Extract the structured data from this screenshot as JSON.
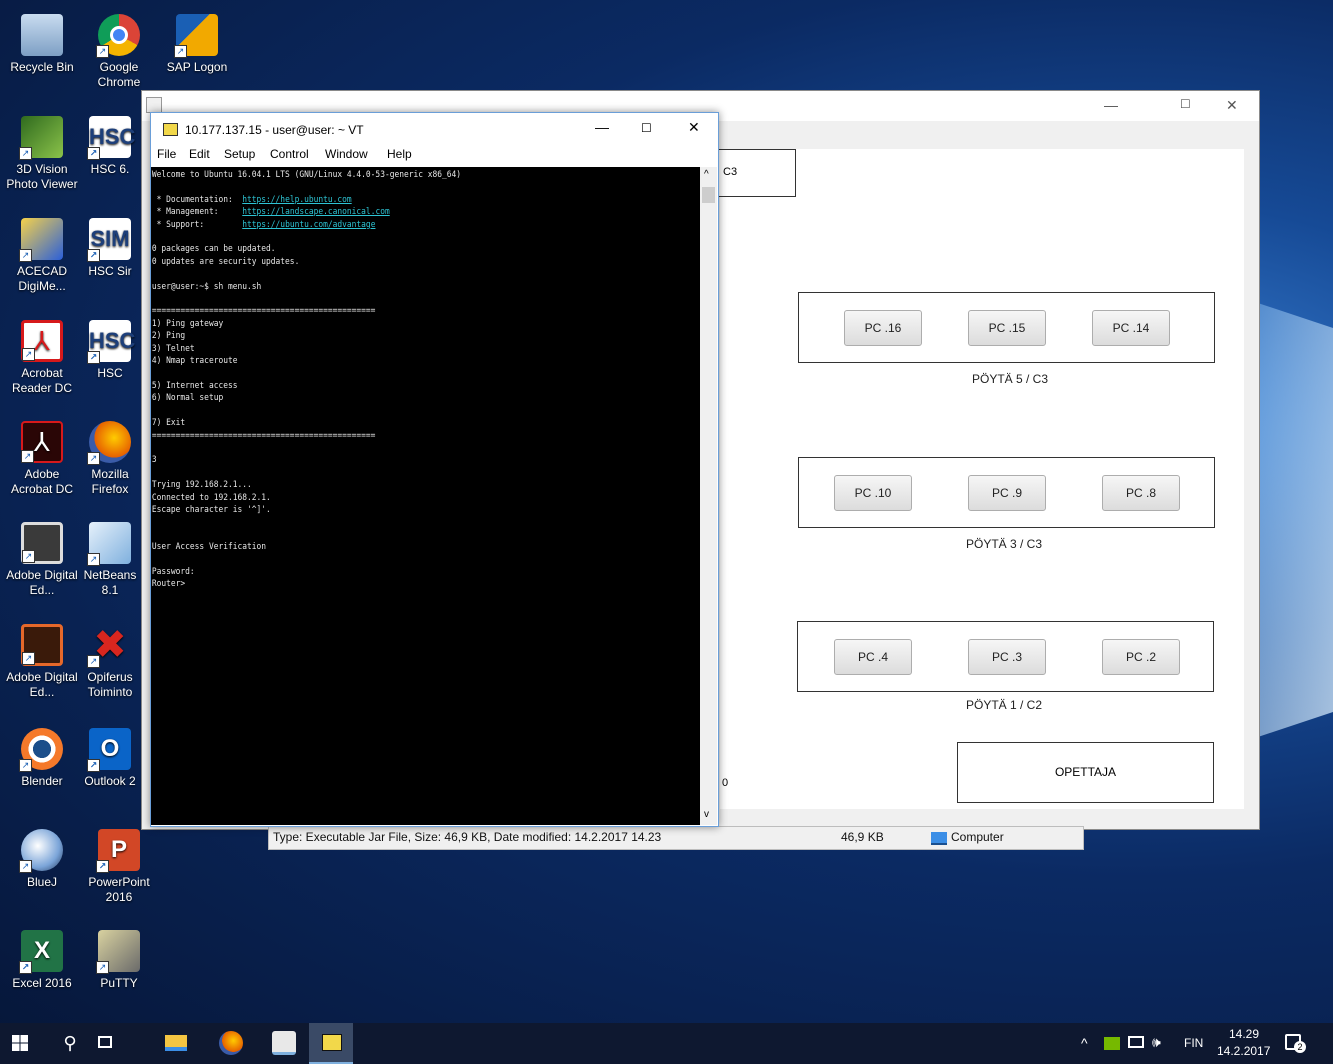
{
  "desktop": {
    "icons": [
      {
        "label": "Recycle Bin",
        "icon": "recycle-bin-icon",
        "color": "#9ab8d8"
      },
      {
        "label": "Google Chrome",
        "icon": "chrome-icon",
        "color": "#db4437"
      },
      {
        "label": "SAP Logon",
        "icon": "sap-logon-icon",
        "color": "#f2a900"
      },
      {
        "label": "3D Vision Photo Viewer",
        "icon": "3d-vision-icon",
        "color": "#4a8a2a"
      },
      {
        "label": "HSC 6.",
        "icon": "hsc-icon",
        "color": "#2a4f8f"
      },
      {
        "label": "ACECAD DigiMe...",
        "icon": "acecad-icon",
        "color": "#2b5fd9"
      },
      {
        "label": "HSC Sir",
        "icon": "hsc-sim-icon",
        "color": "#2a4f8f"
      },
      {
        "label": "Acrobat Reader DC",
        "icon": "acrobat-reader-icon",
        "color": "#d6191b"
      },
      {
        "label": "HSC",
        "icon": "hsc-icon-2",
        "color": "#2a4f8f"
      },
      {
        "label": "Adobe Acrobat DC",
        "icon": "adobe-acrobat-icon",
        "color": "#d6191b"
      },
      {
        "label": "Mozilla Firefox",
        "icon": "firefox-icon",
        "color": "#e66000"
      },
      {
        "label": "Adobe Digital Ed...",
        "icon": "adobe-digital-editions-icon",
        "color": "#4a4a4a"
      },
      {
        "label": "NetBeans 8.1",
        "icon": "netbeans-icon",
        "color": "#9fc6e8"
      },
      {
        "label": "Adobe Digital Ed...",
        "icon": "adobe-digital-editions-icon-2",
        "color": "#e5682a"
      },
      {
        "label": "Opiferus Toiminto",
        "icon": "opiferus-icon",
        "color": "#d8261f"
      },
      {
        "label": "Blender",
        "icon": "blender-icon",
        "color": "#f5792a"
      },
      {
        "label": "Outlook 2",
        "icon": "outlook-icon",
        "color": "#0a64c8"
      },
      {
        "label": "BlueJ",
        "icon": "bluej-icon",
        "color": "#7aa4d8"
      },
      {
        "label": "PowerPoint 2016",
        "icon": "powerpoint-icon",
        "color": "#d24726"
      },
      {
        "label": "Excel 2016",
        "icon": "excel-icon",
        "color": "#217346"
      },
      {
        "label": "PuTTY",
        "icon": "putty-icon",
        "color": "#d9d2a0"
      }
    ]
  },
  "java_app": {
    "title_icon": "java-icon",
    "partial_label_c3": "C3",
    "partial_label_0": "0",
    "desks": [
      {
        "label": "PÖYTÄ 5 / C3",
        "pcs": [
          "PC .16",
          "PC .15",
          "PC .14"
        ]
      },
      {
        "label": "PÖYTÄ 3 / C3",
        "pcs": [
          "PC .10",
          "PC .9",
          "PC .8"
        ]
      },
      {
        "label": "PÖYTÄ 1 / C2",
        "pcs": [
          "PC .4",
          "PC .3",
          "PC .2"
        ]
      }
    ],
    "teacher": "OPETTAJA"
  },
  "explorer_strip": {
    "type_info": "Type: Executable Jar File, Size: 46,9 KB, Date modified: 14.2.2017 14.23",
    "size": "46,9 KB",
    "location": "Computer"
  },
  "terminal": {
    "title": "10.177.137.15 - user@user: ~ VT",
    "menu": [
      "File",
      "Edit",
      "Setup",
      "Control",
      "Window",
      "Help"
    ],
    "lines": {
      "welcome": "Welcome to Ubuntu 16.04.1 LTS (GNU/Linux 4.4.0-53-generic x86_64)",
      "doc_label": " * Documentation:  ",
      "doc_url": "https://help.ubuntu.com",
      "mgmt_label": " * Management:     ",
      "mgmt_url": "https://landscape.canonical.com",
      "support_label": " * Support:        ",
      "support_url": "https://ubuntu.com/advantage",
      "pkgs": "0 packages can be updated.",
      "sec": "0 updates are security updates.",
      "prompt": "user@user:~$ sh menu.sh",
      "sep1": "===============================================",
      "m1": "1) Ping gateway",
      "m2": "2) Ping",
      "m3": "3) Telnet",
      "m4": "4) Nmap traceroute",
      "m5": "5) Internet access",
      "m6": "6) Normal setup",
      "m7": "7) Exit",
      "sep2": "===============================================",
      "choice": "3",
      "trying": "Trying 192.168.2.1...",
      "connected": "Connected to 192.168.2.1.",
      "escape": "Escape character is '^]'.",
      "uav": "User Access Verification",
      "password": "Password:",
      "router": "Router>"
    }
  },
  "taskbar": {
    "language": "FIN",
    "time": "14.29",
    "date": "14.2.2017",
    "notifications": "2"
  }
}
